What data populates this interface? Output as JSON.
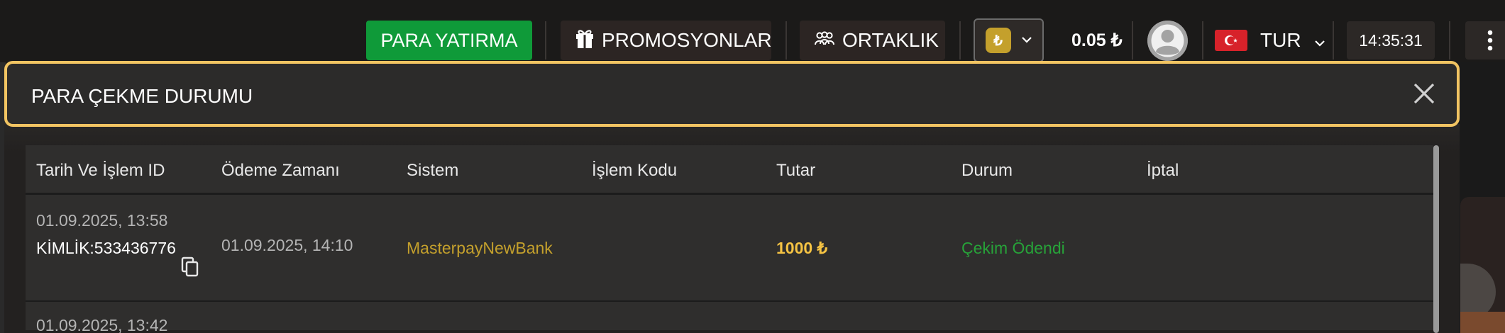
{
  "header": {
    "deposit_label": "PARA YATIRMA",
    "promotions_label": "PROMOSYONLAR",
    "affiliate_label": "ORTAKLIK",
    "currency_symbol": "₺",
    "balance": "0.05 ₺",
    "language": "TUR",
    "time": "14:35:31",
    "colors": {
      "deposit": "#0f9a39",
      "accent": "#f2c462",
      "coin": "#c4a02c"
    }
  },
  "modal": {
    "title": "PARA ÇEKME DURUMU",
    "table": {
      "headers": [
        "Tarih Ve İşlem ID",
        "Ödeme Zamanı",
        "Sistem",
        "İşlem Kodu",
        "Tutar",
        "Durum",
        "İptal"
      ],
      "rows": [
        {
          "date": "01.09.2025, 13:58",
          "id": "KİMLİK:533436776",
          "payment_time": "01.09.2025, 14:10",
          "system": "MasterpayNewBank",
          "code": "",
          "amount": "1000 ₺",
          "status": "Çekim Ödendi",
          "cancel": ""
        },
        {
          "date": "01.09.2025, 13:42"
        }
      ]
    }
  },
  "icons": [
    "gift-icon",
    "people-icon",
    "chevron-down-icon",
    "user-avatar-icon",
    "turkey-flag-icon",
    "kebab-menu-icon",
    "close-icon",
    "copy-icon"
  ]
}
